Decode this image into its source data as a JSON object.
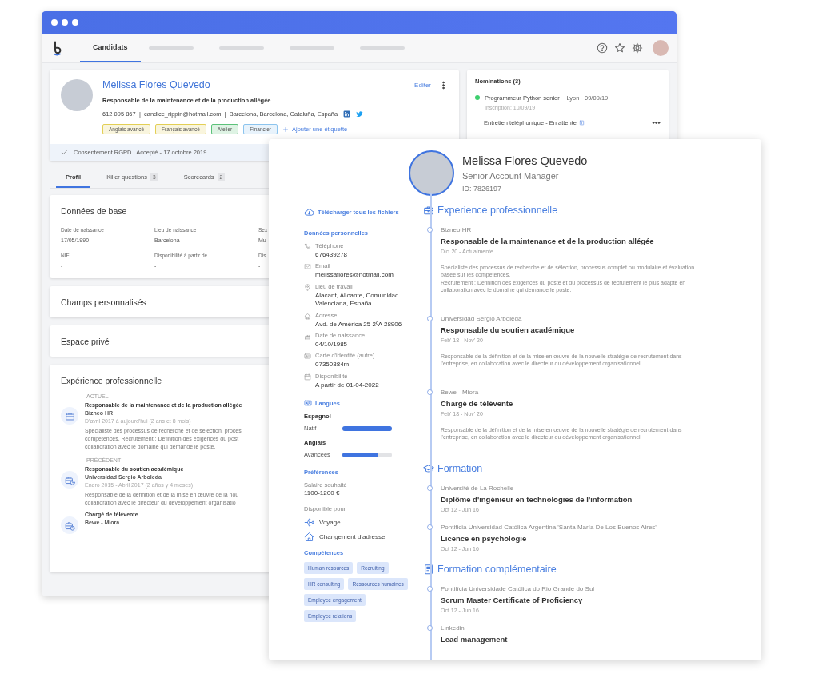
{
  "nav": {
    "tabs": [
      {
        "label": "Candidats",
        "selected": true
      }
    ]
  },
  "profile": {
    "name": "Melissa Flores Quevedo",
    "headline": "Responsable de la maintenance et de la production allégée",
    "contact": "612 095 867  |  candice_rippin@hotmail.com  |  Barcelona, Barcelona, Cataluña, España",
    "edit_label": "Editer",
    "tags": [
      {
        "label": "Anglais avancé",
        "color": "#e3cf55"
      },
      {
        "label": "Français avancé",
        "color": "#e3cf55"
      },
      {
        "label": "Atelier",
        "color": "#5cc27a"
      },
      {
        "label": "Financier",
        "color": "#8cc4ee"
      }
    ],
    "add_tag_label": "Ajouter une étiquette",
    "consent": "Consentement RGPD : Accepté - 17 octobre 2019"
  },
  "nominations": {
    "title": "Nominations (3)",
    "items": [
      {
        "job": "Programmeur Python senior",
        "meta": "· Lyon · 09/09/19",
        "registered": "Inscription: 10/09/19",
        "color": "#3ecf6e"
      }
    ],
    "interview": "Entretien téléphonique - En attente"
  },
  "profile_tabs": [
    {
      "label": "Profil",
      "selected": true
    },
    {
      "label": "Killer questions",
      "count": "3",
      "selected": false
    },
    {
      "label": "Scorecards",
      "count": "2",
      "selected": false
    }
  ],
  "basic_data": {
    "title": "Données de base",
    "fields": [
      {
        "label": "Date de naissance",
        "value": "17/05/1990"
      },
      {
        "label": "Lieu de naissance",
        "value": "Barcelona"
      },
      {
        "label": "Sex",
        "value": "Mu"
      },
      {
        "label": "NIF",
        "value": "-"
      },
      {
        "label": "Disponibilité à partir de",
        "value": "-"
      },
      {
        "label": "Dis",
        "value": "-"
      }
    ]
  },
  "custom_fields": {
    "title": "Champs personnalisés"
  },
  "private_space": {
    "title": "Espace privé"
  },
  "experience": {
    "title": "Expérience professionnelle",
    "groups": [
      {
        "heading": "ACTUEL",
        "items": [
          {
            "kind": "current",
            "title": "Responsable de la maintenance et de la production allégée",
            "company": "Bizneo HR",
            "dates": "D'avril 2017 à aujourd'hui (2 ans et 8 mois)",
            "description_lines": [
              "Spécialiste des processus de recherche et de sélection, proces",
              "compétences. Recrutement : Définition des exigences du post",
              "collaboration avec le domaine qui demande le poste."
            ]
          }
        ]
      },
      {
        "heading": "PRÉCÉDENT",
        "items": [
          {
            "kind": "past",
            "title": "Responsable du soutien académique",
            "company": "Universidad Sergio Arboleda",
            "dates": "Enero 2015 - Abril 2017 (2 años y 4 meses)",
            "description_lines": [
              "Responsable de la définition et de la mise en œuvre de la nou",
              "collaboration avec le directeur du développement organisatio"
            ]
          },
          {
            "kind": "past",
            "title": "Chargé de télévente",
            "company": "Bewe - Miora"
          }
        ]
      }
    ]
  },
  "cv": {
    "name": "Melissa Flores Quevedo",
    "role": "Senior Account Manager",
    "id": "ID: 7826197",
    "download_label": "Télécharger tous les fichiers",
    "personal": {
      "title": "Données personnelles",
      "items": [
        {
          "kind": "phone",
          "label": "Téléphone",
          "value": "676439278"
        },
        {
          "kind": "email",
          "label": "Email",
          "value": "melissaflores@hotmail.com"
        },
        {
          "kind": "location",
          "label": "Lieu de travail",
          "value": "Alacant, Alicante, Comunidad Valenciana, España"
        },
        {
          "kind": "address",
          "label": "Adresse",
          "value": "Avd. de América 25 2ºA 28906"
        },
        {
          "kind": "birthday",
          "label": "Date de naissance",
          "value": "04/10/1985"
        },
        {
          "kind": "id",
          "label": "Carte d'identité (autre)",
          "value": "07350384m"
        },
        {
          "kind": "availability",
          "label": "Disponibilité",
          "value": "A partir de 01-04-2022"
        }
      ]
    },
    "languages": {
      "title": "Langues",
      "items": [
        {
          "name": "Espagnol",
          "level_label": "Natif",
          "level": 1.0
        },
        {
          "name": "Anglais",
          "level_label": "Avancées",
          "level": 0.72
        }
      ]
    },
    "preferences": {
      "title": "Préférences",
      "salary_label": "Salaire souhaité",
      "salary": "1100-1200 €",
      "available_label": "Disponible pour",
      "options": [
        {
          "kind": "travel",
          "label": "Voyage"
        },
        {
          "kind": "relocation",
          "label": "Changement d'adresse"
        }
      ]
    },
    "skills": {
      "title": "Compétences",
      "tags": [
        "Human resources",
        "Recruiting",
        "HR consulting",
        "Ressources humaines",
        "Employee engagement",
        "Employee relations"
      ]
    },
    "sections": [
      {
        "kind": "work",
        "title": "Experience professionnelle",
        "entries": [
          {
            "org": "Bizneo HR",
            "title": "Responsable de la maintenance et de la production allégée",
            "dates": "Dic' 20 - Actualmente",
            "description": [
              "Spécialiste des processus de recherche et de sélection, processus complet ou modulaire et évaluation basée sur les compétences.",
              "Recrutement : Définition des exigences du poste et du processus de recrutement le plus adapté en collaboration avec le domaine qui demande le poste."
            ]
          },
          {
            "org": "Universidad Sergio Arboleda",
            "title": "Responsable du soutien académique",
            "dates": "Feb' 18 - Nov' 20",
            "description": [
              "Responsable de la définition et de la mise en œuvre de la nouvelle stratégie de recrutement dans l'entreprise, en collaboration avec le directeur du développement organisationnel."
            ]
          },
          {
            "org": "Bewe - Miora",
            "title": "Chargé de télévente",
            "dates": "Feb' 18 - Nov' 20",
            "description": [
              "Responsable de la définition et de la mise en œuvre de la nouvelle stratégie de recrutement dans l'entreprise, en collaboration avec le directeur du développement organisationnel."
            ]
          }
        ]
      },
      {
        "kind": "education",
        "title": "Formation",
        "entries": [
          {
            "org": "Université de La Rochelle",
            "title": "Diplôme d'ingénieur en technologies de l'information",
            "dates": "Oct 12 - Jun 16"
          },
          {
            "org": "Pontificia Universidad Católica Argentina 'Santa María De Los Buenos Aires'",
            "title": "Licence en psychologie",
            "dates": "Oct 12 - Jun 16"
          }
        ]
      },
      {
        "kind": "training",
        "title": "Formation complémentaire",
        "entries": [
          {
            "org": "Pontifícia Universidade Católica do Rio Grande do Sul",
            "title": "Scrum Master Certificate of Proficiency",
            "dates": "Oct 12 - Jun 16"
          },
          {
            "org": "Linkedin",
            "title": "Lead management"
          }
        ]
      }
    ]
  }
}
